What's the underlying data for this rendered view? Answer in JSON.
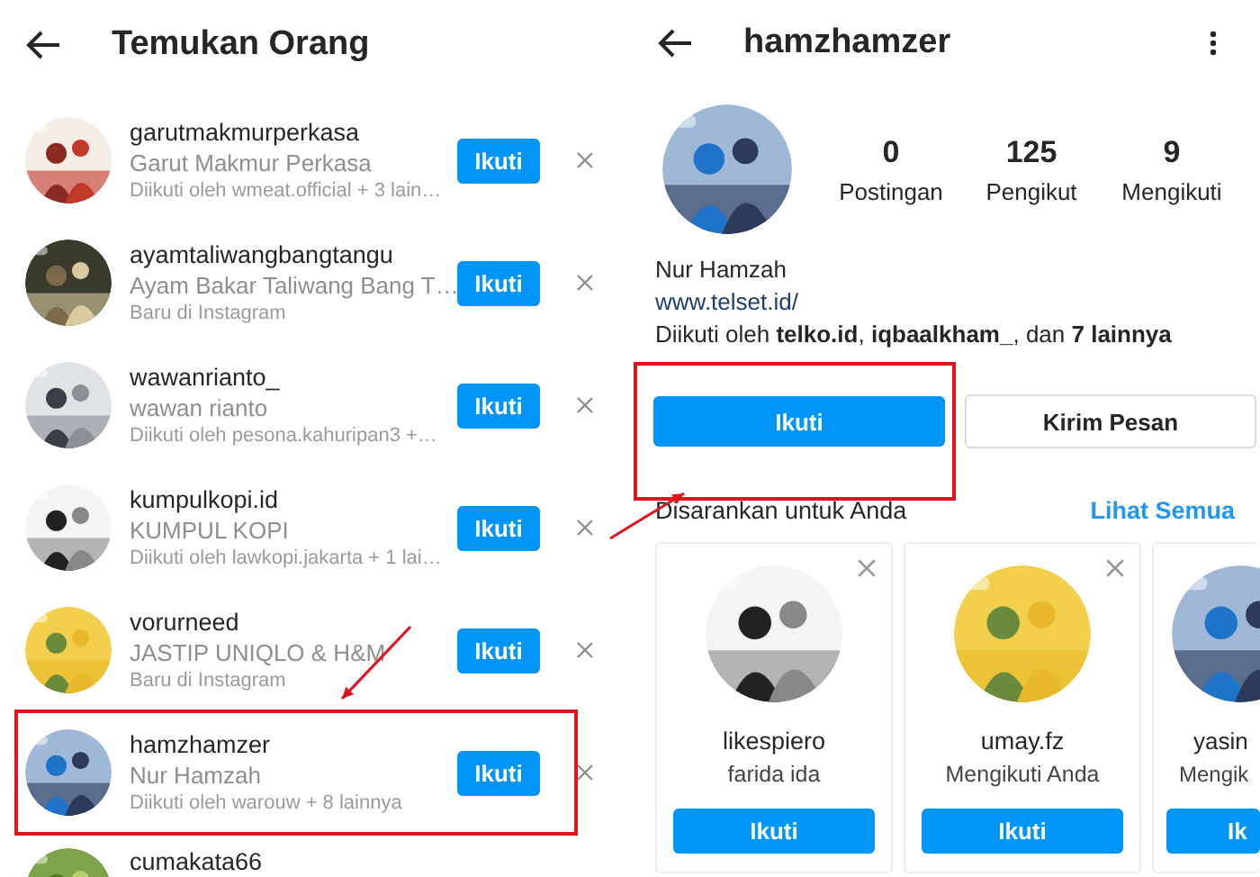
{
  "left_screen": {
    "title": "Temukan Orang",
    "people": [
      {
        "username": "garutmakmurperkasa",
        "full_name": "Garut Makmur Perkasa",
        "subtitle": "Diikuti oleh wmeat.official + 3 lain…",
        "button": "Ikuti",
        "highlighted": false
      },
      {
        "username": "ayamtaliwangbangtangu",
        "full_name": "Ayam Bakar Taliwang Bang T…",
        "subtitle": "Baru di Instagram",
        "button": "Ikuti",
        "highlighted": false
      },
      {
        "username": "wawanrianto_",
        "full_name": "wawan rianto",
        "subtitle": "Diikuti oleh pesona.kahuripan3 +…",
        "button": "Ikuti",
        "highlighted": false
      },
      {
        "username": "kumpulkopi.id",
        "full_name": "KUMPUL KOPI",
        "subtitle": "Diikuti oleh lawkopi.jakarta + 1 lai…",
        "button": "Ikuti",
        "highlighted": false
      },
      {
        "username": "vorurneed",
        "full_name": "JASTIP UNIQLO &  H&M",
        "subtitle": "Baru di Instagram",
        "button": "Ikuti",
        "highlighted": false
      },
      {
        "username": "hamzhamzer",
        "full_name": "Nur Hamzah",
        "subtitle": "Diikuti oleh warouw + 8 lainnya",
        "button": "Ikuti",
        "highlighted": true
      },
      {
        "username": "cumakata66"
      }
    ]
  },
  "right_screen": {
    "title": "hamzhamzer",
    "stats": [
      {
        "value": "0",
        "label": "Postingan"
      },
      {
        "value": "125",
        "label": "Pengikut"
      },
      {
        "value": "9",
        "label": "Mengikuti"
      }
    ],
    "name": "Nur Hamzah",
    "link": "www.telset.id/",
    "followed_by": "Diikuti oleh **telko.id**, **iqbaalkham_**, dan **7 lainnya**",
    "follow_button": {
      "label": "Ikuti",
      "highlighted": true
    },
    "message_button": "Kirim Pesan",
    "suggested": {
      "title": "Disarankan untuk Anda",
      "see_all": "Lihat Semua",
      "cards": [
        {
          "username": "likespiero",
          "subtitle": "farida ida",
          "button": "Ikuti"
        },
        {
          "username": "umay.fz",
          "subtitle": "Mengikuti Anda",
          "button": "Ikuti"
        },
        {
          "username": "yasin",
          "subtitle": "Mengik",
          "button": "Ik"
        }
      ]
    }
  }
}
